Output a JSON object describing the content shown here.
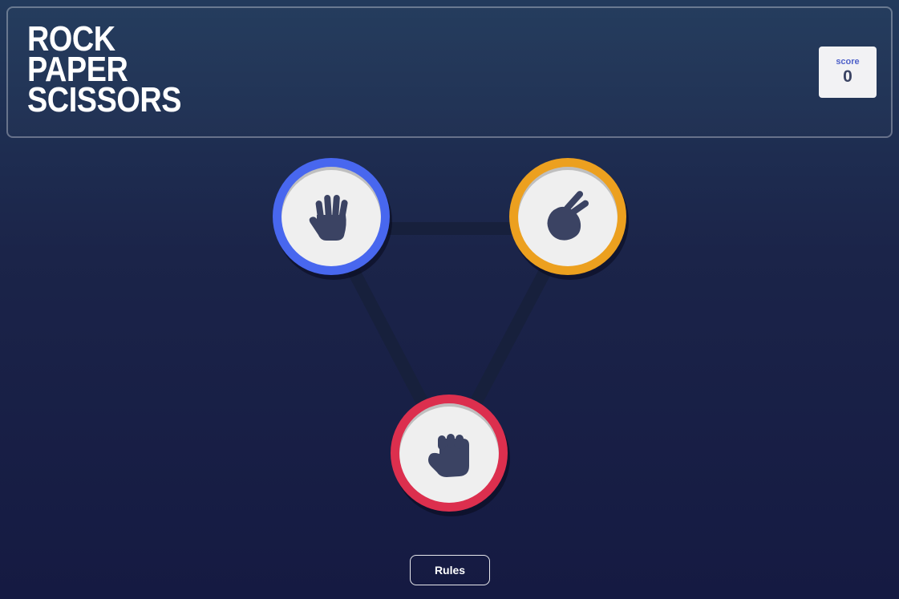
{
  "header": {
    "title_lines": [
      "ROCK",
      "PAPER",
      "SCISSORS"
    ],
    "score_label": "score",
    "score_value": "0"
  },
  "choices": [
    {
      "name": "paper",
      "icon": "hand-paper-icon",
      "ring_color": "#4867ef"
    },
    {
      "name": "scissors",
      "icon": "hand-scissors-icon",
      "ring_color": "#eca01f"
    },
    {
      "name": "rock",
      "icon": "hand-rock-icon",
      "ring_color": "#dc2f4e"
    }
  ],
  "rules_button": {
    "label": "Rules"
  },
  "colors": {
    "background_top": "#223a5c",
    "background_bottom": "#151a42",
    "icon_fill": "#3b4363",
    "triangle_line": "#17203c"
  }
}
